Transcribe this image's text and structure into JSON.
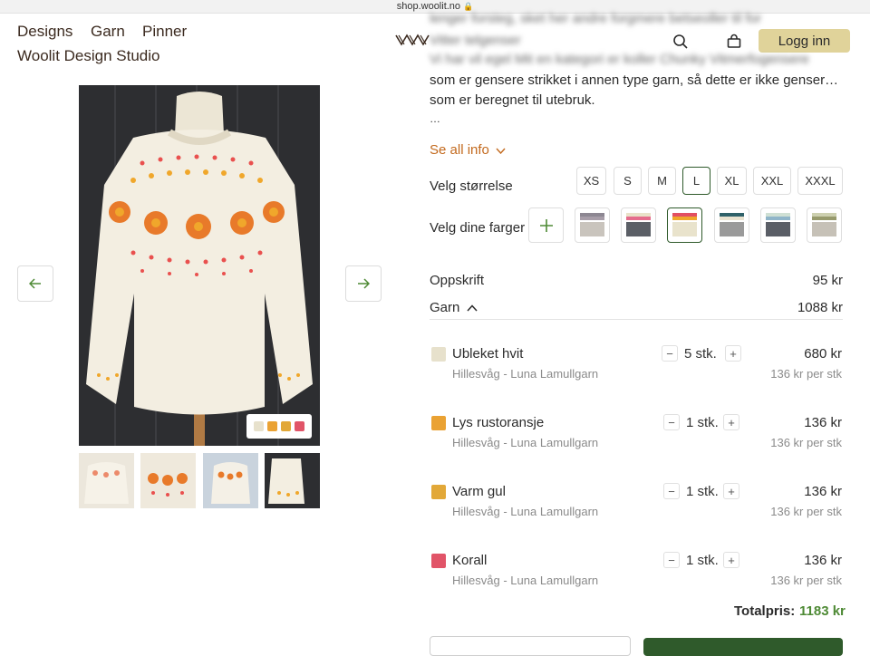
{
  "browser": {
    "url": "shop.woolit.no"
  },
  "nav": {
    "items": [
      "Designs",
      "Garn",
      "Pinner"
    ],
    "studio": "Woolit Design Studio",
    "login": "Logg inn"
  },
  "description": {
    "blurred_lines": [
      "lenger forsteg, sket her andre forgmere betseoller til for",
      "Vitter telgenser",
      "Vi har vil egel Mit en kategori er koller Chunky Vitmerfogensere"
    ],
    "lines": [
      "som er gensere strikket i annen type garn, så dette er ikke genser…",
      "som er beregnet til utebruk.",
      "…"
    ],
    "see_all": "Se all info"
  },
  "size": {
    "label": "Velg størrelse",
    "options": [
      "XS",
      "S",
      "M",
      "L",
      "XL",
      "XXL",
      "XXXL"
    ],
    "selected": "L"
  },
  "colors": {
    "label": "Velg dine farger",
    "options": [
      {
        "name": "gray-mauve",
        "bar1": "#8d8792",
        "bar2": "#a79da8",
        "block": "#c9c4bd"
      },
      {
        "name": "pink-dark",
        "bar1": "#e9e2c9",
        "bar2": "#e56c8c",
        "block": "#5b5f66"
      },
      {
        "name": "orange-cream",
        "bar1": "#e24f62",
        "bar2": "#f0a72b",
        "block": "#e9e3cc"
      },
      {
        "name": "teal-dark",
        "bar1": "#2f6169",
        "bar2": "#e9e3d0",
        "block": "#9a9a9a"
      },
      {
        "name": "blue-dark",
        "bar1": "#cfe0d4",
        "bar2": "#8fb5c9",
        "block": "#5a5e66"
      },
      {
        "name": "olive-gray",
        "bar1": "#cdd0b0",
        "bar2": "#979a6c",
        "block": "#c6c1b7"
      }
    ],
    "selected_index": 2
  },
  "pricing": {
    "pattern_label": "Oppskrift",
    "pattern_price": "95 kr",
    "yarn_label": "Garn",
    "yarn_price": "1088 kr"
  },
  "yarns": [
    {
      "name": "Ubleket hvit",
      "supplier": "Hillesvåg - Luna Lamullgarn",
      "qty": "5 stk.",
      "price": "680 kr",
      "unit_price": "136 kr per stk",
      "color": "#e7e1cc"
    },
    {
      "name": "Lys rustoransje",
      "supplier": "Hillesvåg - Luna Lamullgarn",
      "qty": "1 stk.",
      "price": "136 kr",
      "unit_price": "136 kr per stk",
      "color": "#eaa233"
    },
    {
      "name": "Varm gul",
      "supplier": "Hillesvåg - Luna Lamullgarn",
      "qty": "1 stk.",
      "price": "136 kr",
      "unit_price": "136 kr per stk",
      "color": "#e2a838"
    },
    {
      "name": "Korall",
      "supplier": "Hillesvåg - Luna Lamullgarn",
      "qty": "1 stk.",
      "price": "136 kr",
      "unit_price": "136 kr per stk",
      "color": "#e15468"
    }
  ],
  "total": {
    "label": "Totalpris:",
    "value": "1183 kr"
  },
  "image_swatches": [
    "#e7e1cc",
    "#eaa233",
    "#e2a838",
    "#e15468"
  ],
  "accent": "#4e8a35",
  "link_color": "#c36a1e"
}
